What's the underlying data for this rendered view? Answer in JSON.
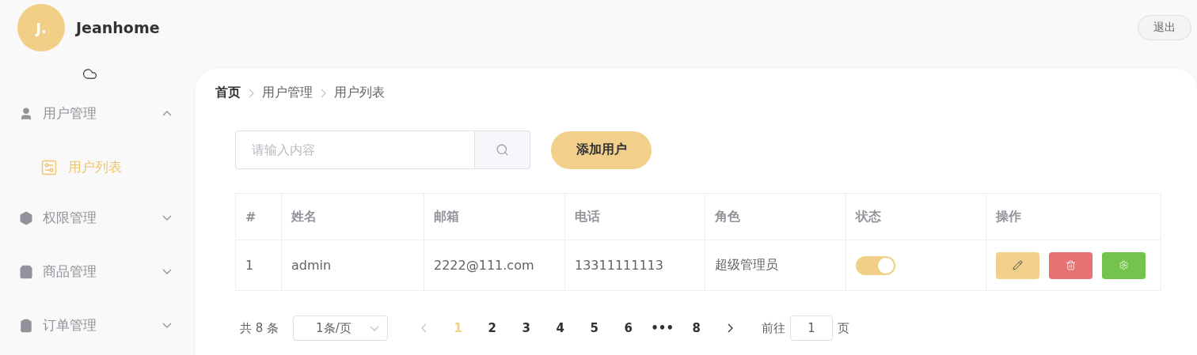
{
  "header": {
    "avatar": "J.",
    "username": "Jeanhome",
    "logout": "退出"
  },
  "sidebar": {
    "items": [
      {
        "label": "用户管理",
        "expanded": true,
        "children": [
          {
            "label": "用户列表",
            "selected": true
          }
        ]
      },
      {
        "label": "权限管理",
        "expanded": false
      },
      {
        "label": "商品管理",
        "expanded": false
      },
      {
        "label": "订单管理",
        "expanded": false
      }
    ]
  },
  "breadcrumb": [
    "首页",
    "用户管理",
    "用户列表"
  ],
  "search": {
    "placeholder": "请输入内容"
  },
  "add_button": "添加用户",
  "table": {
    "columns": [
      "#",
      "姓名",
      "邮箱",
      "电话",
      "角色",
      "状态",
      "操作"
    ],
    "rows": [
      {
        "cells": [
          "1",
          "admin",
          "2222@111.com",
          "13311111113",
          "超级管理员"
        ],
        "status_on": true
      }
    ]
  },
  "pagination": {
    "total": "共 8 条",
    "page_size": "1条/页",
    "pages": [
      {
        "label": "1",
        "selected": true
      },
      {
        "label": "2",
        "selected": false
      },
      {
        "label": "3",
        "selected": false
      },
      {
        "label": "4",
        "selected": false
      },
      {
        "label": "5",
        "selected": false
      },
      {
        "label": "6",
        "selected": false
      },
      {
        "label": "•••",
        "selected": false
      },
      {
        "label": "8",
        "selected": false
      }
    ],
    "jump_label": "前往",
    "jump_value": "1",
    "jump_suffix": "页"
  }
}
